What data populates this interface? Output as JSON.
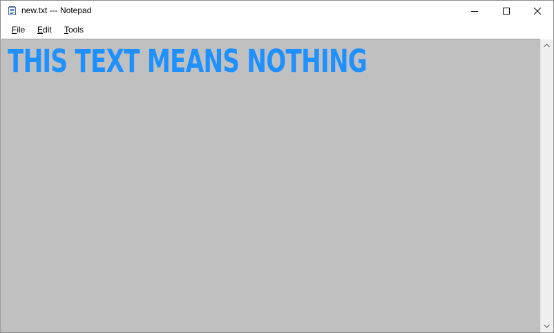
{
  "window": {
    "title": "new.txt --- Notepad",
    "app_icon": "notepad-icon",
    "controls": {
      "minimize_icon": "minimize-icon",
      "maximize_icon": "maximize-icon",
      "close_icon": "close-icon"
    }
  },
  "menu": {
    "items": [
      {
        "accel": "F",
        "rest": "ile"
      },
      {
        "accel": "E",
        "rest": "dit"
      },
      {
        "accel": "T",
        "rest": "ools"
      }
    ]
  },
  "editor": {
    "content": "THIS TEXT MEANS NOTHING",
    "text_color": "#1e90ff",
    "background_color": "#c0c0c0"
  },
  "scrollbar": {
    "up_icon": "chevron-up-icon",
    "down_icon": "chevron-down-icon"
  }
}
